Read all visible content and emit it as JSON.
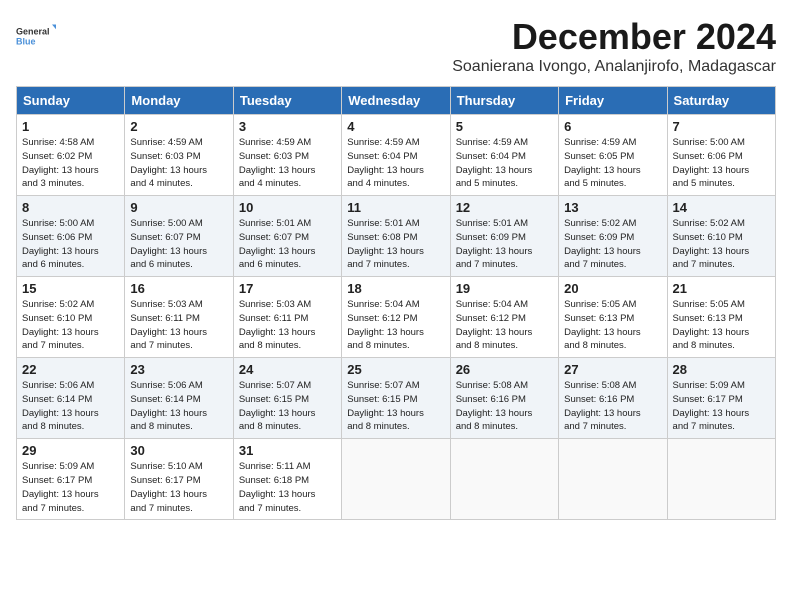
{
  "logo": {
    "line1": "General",
    "line2": "Blue"
  },
  "title": "December 2024",
  "location": "Soanierana Ivongo, Analanjirofo, Madagascar",
  "days_of_week": [
    "Sunday",
    "Monday",
    "Tuesday",
    "Wednesday",
    "Thursday",
    "Friday",
    "Saturday"
  ],
  "weeks": [
    [
      {
        "day": "1",
        "sunrise": "4:58 AM",
        "sunset": "6:02 PM",
        "daylight": "13 hours and 3 minutes."
      },
      {
        "day": "2",
        "sunrise": "4:59 AM",
        "sunset": "6:03 PM",
        "daylight": "13 hours and 4 minutes."
      },
      {
        "day": "3",
        "sunrise": "4:59 AM",
        "sunset": "6:03 PM",
        "daylight": "13 hours and 4 minutes."
      },
      {
        "day": "4",
        "sunrise": "4:59 AM",
        "sunset": "6:04 PM",
        "daylight": "13 hours and 4 minutes."
      },
      {
        "day": "5",
        "sunrise": "4:59 AM",
        "sunset": "6:04 PM",
        "daylight": "13 hours and 5 minutes."
      },
      {
        "day": "6",
        "sunrise": "4:59 AM",
        "sunset": "6:05 PM",
        "daylight": "13 hours and 5 minutes."
      },
      {
        "day": "7",
        "sunrise": "5:00 AM",
        "sunset": "6:06 PM",
        "daylight": "13 hours and 5 minutes."
      }
    ],
    [
      {
        "day": "8",
        "sunrise": "5:00 AM",
        "sunset": "6:06 PM",
        "daylight": "13 hours and 6 minutes."
      },
      {
        "day": "9",
        "sunrise": "5:00 AM",
        "sunset": "6:07 PM",
        "daylight": "13 hours and 6 minutes."
      },
      {
        "day": "10",
        "sunrise": "5:01 AM",
        "sunset": "6:07 PM",
        "daylight": "13 hours and 6 minutes."
      },
      {
        "day": "11",
        "sunrise": "5:01 AM",
        "sunset": "6:08 PM",
        "daylight": "13 hours and 7 minutes."
      },
      {
        "day": "12",
        "sunrise": "5:01 AM",
        "sunset": "6:09 PM",
        "daylight": "13 hours and 7 minutes."
      },
      {
        "day": "13",
        "sunrise": "5:02 AM",
        "sunset": "6:09 PM",
        "daylight": "13 hours and 7 minutes."
      },
      {
        "day": "14",
        "sunrise": "5:02 AM",
        "sunset": "6:10 PM",
        "daylight": "13 hours and 7 minutes."
      }
    ],
    [
      {
        "day": "15",
        "sunrise": "5:02 AM",
        "sunset": "6:10 PM",
        "daylight": "13 hours and 7 minutes."
      },
      {
        "day": "16",
        "sunrise": "5:03 AM",
        "sunset": "6:11 PM",
        "daylight": "13 hours and 7 minutes."
      },
      {
        "day": "17",
        "sunrise": "5:03 AM",
        "sunset": "6:11 PM",
        "daylight": "13 hours and 8 minutes."
      },
      {
        "day": "18",
        "sunrise": "5:04 AM",
        "sunset": "6:12 PM",
        "daylight": "13 hours and 8 minutes."
      },
      {
        "day": "19",
        "sunrise": "5:04 AM",
        "sunset": "6:12 PM",
        "daylight": "13 hours and 8 minutes."
      },
      {
        "day": "20",
        "sunrise": "5:05 AM",
        "sunset": "6:13 PM",
        "daylight": "13 hours and 8 minutes."
      },
      {
        "day": "21",
        "sunrise": "5:05 AM",
        "sunset": "6:13 PM",
        "daylight": "13 hours and 8 minutes."
      }
    ],
    [
      {
        "day": "22",
        "sunrise": "5:06 AM",
        "sunset": "6:14 PM",
        "daylight": "13 hours and 8 minutes."
      },
      {
        "day": "23",
        "sunrise": "5:06 AM",
        "sunset": "6:14 PM",
        "daylight": "13 hours and 8 minutes."
      },
      {
        "day": "24",
        "sunrise": "5:07 AM",
        "sunset": "6:15 PM",
        "daylight": "13 hours and 8 minutes."
      },
      {
        "day": "25",
        "sunrise": "5:07 AM",
        "sunset": "6:15 PM",
        "daylight": "13 hours and 8 minutes."
      },
      {
        "day": "26",
        "sunrise": "5:08 AM",
        "sunset": "6:16 PM",
        "daylight": "13 hours and 8 minutes."
      },
      {
        "day": "27",
        "sunrise": "5:08 AM",
        "sunset": "6:16 PM",
        "daylight": "13 hours and 7 minutes."
      },
      {
        "day": "28",
        "sunrise": "5:09 AM",
        "sunset": "6:17 PM",
        "daylight": "13 hours and 7 minutes."
      }
    ],
    [
      {
        "day": "29",
        "sunrise": "5:09 AM",
        "sunset": "6:17 PM",
        "daylight": "13 hours and 7 minutes."
      },
      {
        "day": "30",
        "sunrise": "5:10 AM",
        "sunset": "6:17 PM",
        "daylight": "13 hours and 7 minutes."
      },
      {
        "day": "31",
        "sunrise": "5:11 AM",
        "sunset": "6:18 PM",
        "daylight": "13 hours and 7 minutes."
      },
      null,
      null,
      null,
      null
    ]
  ]
}
